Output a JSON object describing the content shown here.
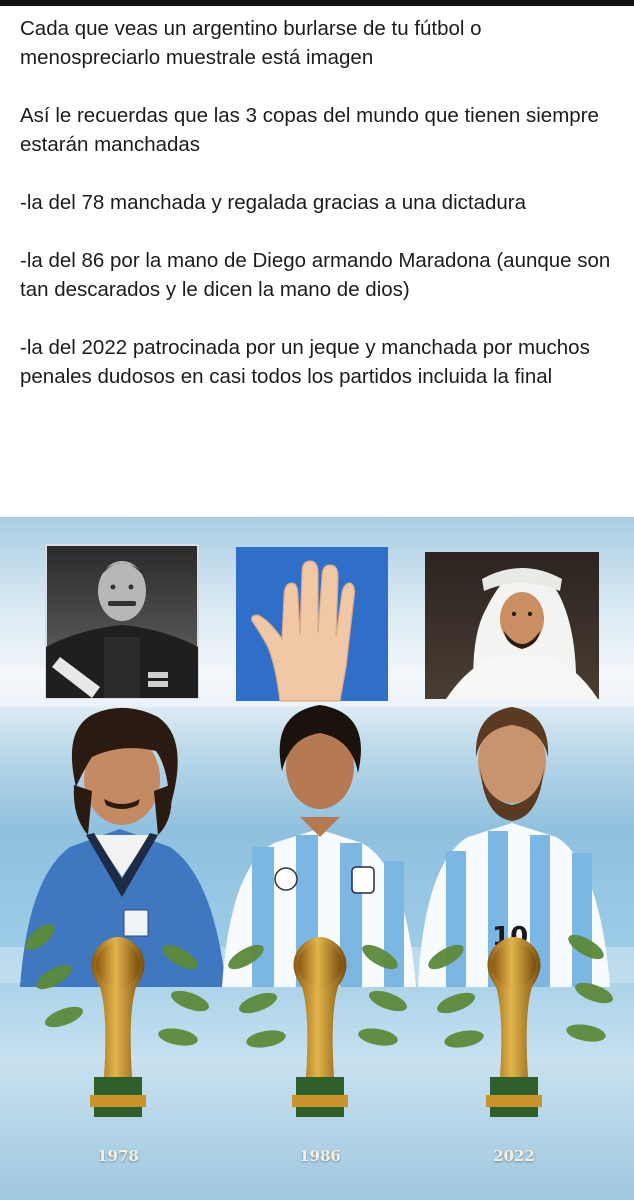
{
  "post": {
    "paragraphs": [
      "Cada que veas un argentino burlarse de tu fútbol o menospreciarlo muestrale está imagen",
      "Así le recuerdas que las 3 copas del mundo que tienen siempre estarán manchadas",
      "-la del 78 manchada y regalada gracias a una dictadura",
      "-la del 86 por la mano de Diego armando Maradona (aunque son tan descarados y le dicen la mano de dios)",
      "-la del 2022 patrocinada por un jeque y manchada por muchos penales dudosos en casi todos los partidos incluida la final"
    ]
  },
  "poster": {
    "years": [
      "1978",
      "1986",
      "2022"
    ],
    "jersey_number": "10",
    "colors": {
      "sky_blue": "#8fc0de",
      "trophy_gold": "#c9952b",
      "laurel_green": "#5c8a3a",
      "jacket_blue": "#3f78c0",
      "hand_panel_blue": "#2f6fc9"
    },
    "panels": [
      "dictator-photo",
      "hand-photo",
      "sheikh-photo"
    ]
  }
}
